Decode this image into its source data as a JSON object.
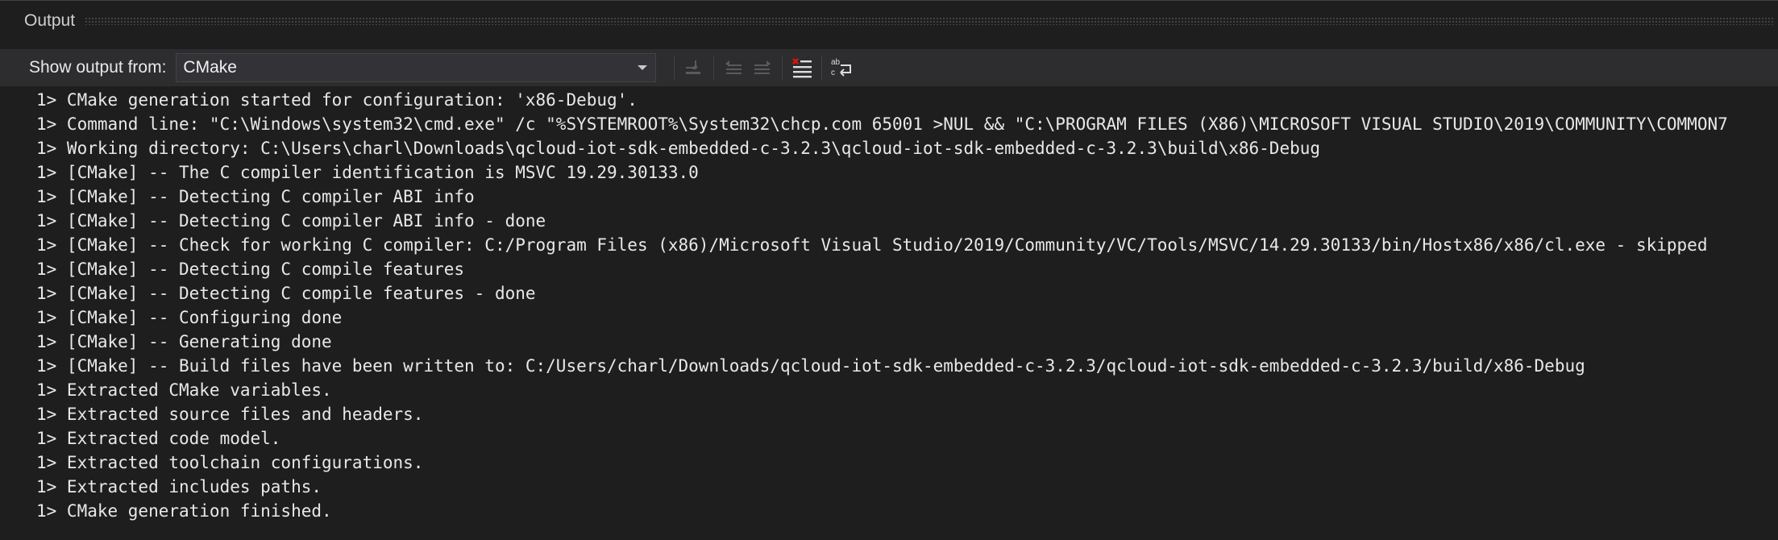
{
  "panel": {
    "title": "Output"
  },
  "toolbar": {
    "show_output_from_label": "Show output from:",
    "source_value": "CMake",
    "buttons": {
      "go_to_line_icon": "go-to-line-icon",
      "prev_message_icon": "previous-message-icon",
      "next_message_icon": "next-message-icon",
      "clear_all_icon": "clear-all-icon",
      "word_wrap_icon": "word-wrap-icon"
    }
  },
  "output_lines": [
    "1> CMake generation started for configuration: 'x86-Debug'.",
    "1> Command line: \"C:\\Windows\\system32\\cmd.exe\" /c \"%SYSTEMROOT%\\System32\\chcp.com 65001 >NUL && \"C:\\PROGRAM FILES (X86)\\MICROSOFT VISUAL STUDIO\\2019\\COMMUNITY\\COMMON7",
    "1> Working directory: C:\\Users\\charl\\Downloads\\qcloud-iot-sdk-embedded-c-3.2.3\\qcloud-iot-sdk-embedded-c-3.2.3\\build\\x86-Debug",
    "1> [CMake] -- The C compiler identification is MSVC 19.29.30133.0",
    "1> [CMake] -- Detecting C compiler ABI info",
    "1> [CMake] -- Detecting C compiler ABI info - done",
    "1> [CMake] -- Check for working C compiler: C:/Program Files (x86)/Microsoft Visual Studio/2019/Community/VC/Tools/MSVC/14.29.30133/bin/Hostx86/x86/cl.exe - skipped",
    "1> [CMake] -- Detecting C compile features",
    "1> [CMake] -- Detecting C compile features - done",
    "1> [CMake] -- Configuring done",
    "1> [CMake] -- Generating done",
    "1> [CMake] -- Build files have been written to: C:/Users/charl/Downloads/qcloud-iot-sdk-embedded-c-3.2.3/qcloud-iot-sdk-embedded-c-3.2.3/build/x86-Debug",
    "1> Extracted CMake variables.",
    "1> Extracted source files and headers.",
    "1> Extracted code model.",
    "1> Extracted toolchain configurations.",
    "1> Extracted includes paths.",
    "1> CMake generation finished."
  ],
  "colors": {
    "background": "#1e1e1e",
    "toolbar": "#2d2d30",
    "text": "#e8e8e8",
    "accent_red": "#e51400"
  }
}
